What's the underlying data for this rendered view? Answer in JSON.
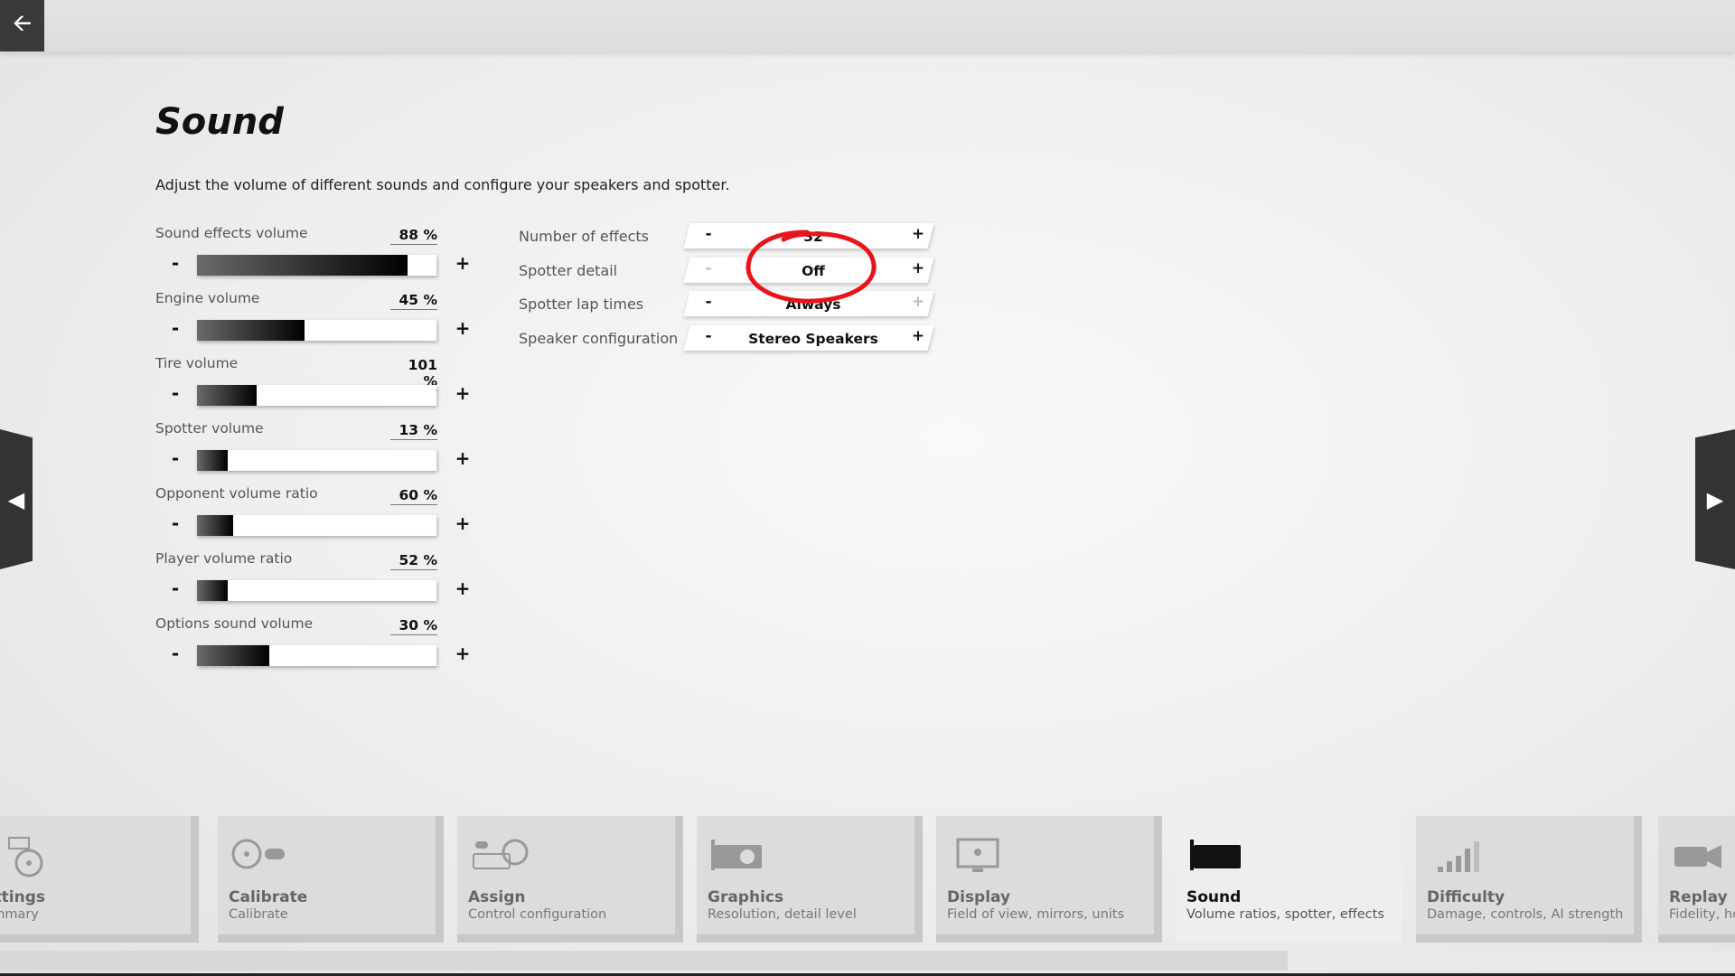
{
  "header": {
    "back_icon": "arrow-left-icon"
  },
  "page": {
    "title": "Sound",
    "description": "Adjust the volume of different sounds and configure your speakers and spotter."
  },
  "sliders": [
    {
      "label": "Sound effects volume",
      "value": "88 %",
      "level": 0.88,
      "minus": "-",
      "plus": "+"
    },
    {
      "label": "Engine volume",
      "value": "45 %",
      "level": 0.45,
      "minus": "-",
      "plus": "+"
    },
    {
      "label": "Tire volume",
      "value": "101 %",
      "level": 0.25,
      "minus": "-",
      "plus": "+"
    },
    {
      "label": "Spotter volume",
      "value": "13 %",
      "level": 0.13,
      "minus": "-",
      "plus": "+"
    },
    {
      "label": "Opponent volume ratio",
      "value": "60 %",
      "level": 0.15,
      "minus": "-",
      "plus": "+"
    },
    {
      "label": "Player volume ratio",
      "value": "52 %",
      "level": 0.13,
      "minus": "-",
      "plus": "+"
    },
    {
      "label": "Options sound volume",
      "value": "30 %",
      "level": 0.3,
      "minus": "-",
      "plus": "+"
    }
  ],
  "options": [
    {
      "label": "Number of effects",
      "value": "32",
      "minus": "-",
      "plus": "+"
    },
    {
      "label": "Spotter detail",
      "value": "Off",
      "minus": "-",
      "plus": "+"
    },
    {
      "label": "Spotter lap times",
      "value": "Always",
      "minus": "-",
      "plus": "+"
    },
    {
      "label": "Speaker configuration",
      "value": "Stereo Speakers",
      "minus": "-",
      "plus": "+"
    }
  ],
  "nav": {
    "prev_icon": "triangle-left-icon",
    "next_icon": "triangle-right-icon"
  },
  "tiles": [
    {
      "title": "ettings",
      "subtitle": "ummary",
      "icon": "settings-summary-icon"
    },
    {
      "title": "Calibrate",
      "subtitle": "Calibrate",
      "icon": "wheel-gamepad-icon"
    },
    {
      "title": "Assign",
      "subtitle": "Control configuration",
      "icon": "keyboard-wheel-icon"
    },
    {
      "title": "Graphics",
      "subtitle": "Resolution, detail level",
      "icon": "gpu-card-icon"
    },
    {
      "title": "Display",
      "subtitle": "Field of view, mirrors, units",
      "icon": "monitor-icon"
    },
    {
      "title": "Sound",
      "subtitle": "Volume ratios, spotter, effects",
      "icon": "audio-card-icon"
    },
    {
      "title": "Difficulty",
      "subtitle": "Damage, controls, AI strength",
      "icon": "signal-bars-icon"
    },
    {
      "title": "Replay",
      "subtitle": "Fidelity, ho",
      "icon": "camera-icon"
    }
  ]
}
